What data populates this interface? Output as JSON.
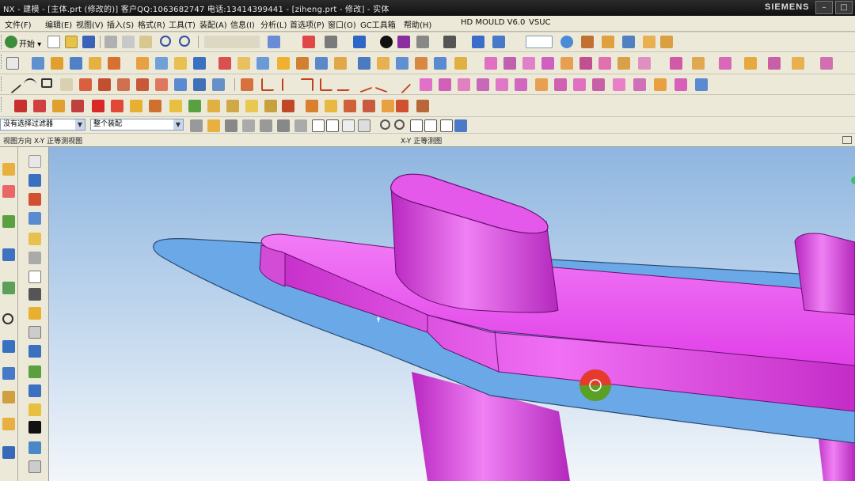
{
  "window": {
    "title": "NX - 建模 - [主体.prt (修改的)] 客户QQ:1063682747 电话:13414399441 - [ziheng.prt - 修改] - 实体",
    "brand": "SIEMENS",
    "controls": [
      "–",
      "□",
      "✕"
    ]
  },
  "menu": {
    "items": [
      "文件(F)",
      "编辑(E)",
      "视图(V)",
      "插入(S)",
      "格式(R)",
      "工具(T)",
      "装配(A)",
      "信息(I)",
      "分析(L)",
      "首选项(P)",
      "窗口(O)",
      "GC工具箱",
      "帮助(H)",
      "HD MOULD V6.0",
      "VSUC"
    ]
  },
  "toolbar": {
    "start_label": "开始 ▾",
    "filter_combo": "没有选择过滤器",
    "assembly_combo": "整个装配"
  },
  "view_header": {
    "left_label": "视图方向 X-Y 正等测视图",
    "center_label": "X-Y 正等测图"
  },
  "colors": {
    "model": "#e040e8",
    "plane": "#6aa8e8",
    "background_top": "#8fb6e0",
    "background_bottom": "#f2f6fa",
    "cursor_ring_red": "#e53a2e",
    "cursor_ring_green": "#5aa024"
  }
}
